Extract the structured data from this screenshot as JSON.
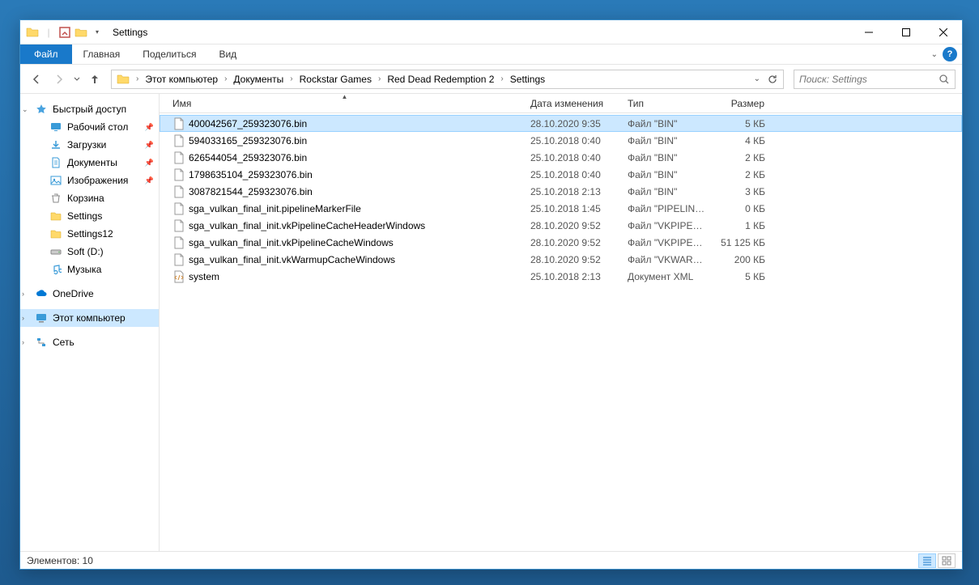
{
  "title": "Settings",
  "tabs": {
    "file": "Файл",
    "home": "Главная",
    "share": "Поделиться",
    "view": "Вид"
  },
  "breadcrumbs": [
    "Этот компьютер",
    "Документы",
    "Rockstar Games",
    "Red Dead Redemption 2",
    "Settings"
  ],
  "search_placeholder": "Поиск: Settings",
  "sidebar": {
    "quick_access": "Быстрый доступ",
    "items": [
      "Рабочий стол",
      "Загрузки",
      "Документы",
      "Изображения",
      "Корзина",
      "Settings",
      "Settings12",
      "Soft (D:)",
      "Музыка"
    ],
    "onedrive": "OneDrive",
    "this_pc": "Этот компьютер",
    "network": "Сеть"
  },
  "columns": {
    "name": "Имя",
    "date": "Дата изменения",
    "type": "Тип",
    "size": "Размер"
  },
  "files": [
    {
      "name": "400042567_259323076.bin",
      "date": "28.10.2020 9:35",
      "type": "Файл \"BIN\"",
      "size": "5 КБ",
      "icon": "file",
      "selected": true
    },
    {
      "name": "594033165_259323076.bin",
      "date": "25.10.2018 0:40",
      "type": "Файл \"BIN\"",
      "size": "4 КБ",
      "icon": "file"
    },
    {
      "name": "626544054_259323076.bin",
      "date": "25.10.2018 0:40",
      "type": "Файл \"BIN\"",
      "size": "2 КБ",
      "icon": "file"
    },
    {
      "name": "1798635104_259323076.bin",
      "date": "25.10.2018 0:40",
      "type": "Файл \"BIN\"",
      "size": "2 КБ",
      "icon": "file"
    },
    {
      "name": "3087821544_259323076.bin",
      "date": "25.10.2018 2:13",
      "type": "Файл \"BIN\"",
      "size": "3 КБ",
      "icon": "file"
    },
    {
      "name": "sga_vulkan_final_init.pipelineMarkerFile",
      "date": "25.10.2018 1:45",
      "type": "Файл \"PIPELINEM...",
      "size": "0 КБ",
      "icon": "file"
    },
    {
      "name": "sga_vulkan_final_init.vkPipelineCacheHeaderWindows",
      "date": "28.10.2020 9:52",
      "type": "Файл \"VKPIPELIN...",
      "size": "1 КБ",
      "icon": "file"
    },
    {
      "name": "sga_vulkan_final_init.vkPipelineCacheWindows",
      "date": "28.10.2020 9:52",
      "type": "Файл \"VKPIPELIN...",
      "size": "51 125 КБ",
      "icon": "file"
    },
    {
      "name": "sga_vulkan_final_init.vkWarmupCacheWindows",
      "date": "28.10.2020 9:52",
      "type": "Файл \"VKWARMU...",
      "size": "200 КБ",
      "icon": "file"
    },
    {
      "name": "system",
      "date": "25.10.2018 2:13",
      "type": "Документ XML",
      "size": "5 КБ",
      "icon": "xml"
    }
  ],
  "status": "Элементов: 10"
}
